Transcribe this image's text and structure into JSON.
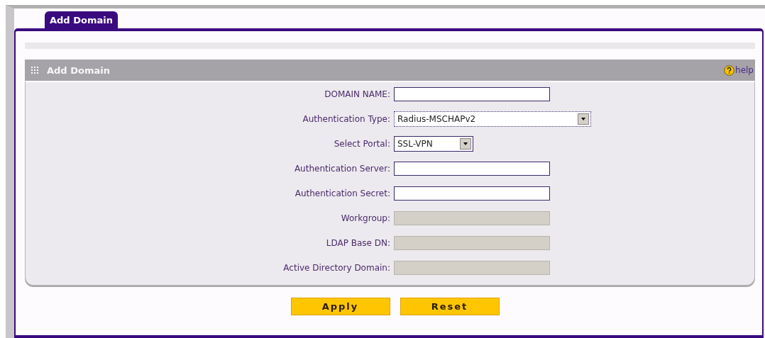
{
  "tabs": [
    {
      "label": "Add Domain",
      "selected": true
    }
  ],
  "section": {
    "title": "Add Domain",
    "help": "help"
  },
  "fields": [
    {
      "label": "DOMAIN NAME:",
      "kind": "text",
      "disabled": false
    },
    {
      "label": "Authentication Type:",
      "kind": "select",
      "value": "Radius-MSCHAPv2",
      "disabled": false
    },
    {
      "label": "Select Portal:",
      "kind": "select",
      "value": "SSL-VPN",
      "disabled": false
    },
    {
      "label": "Authentication Server:",
      "kind": "text",
      "disabled": false
    },
    {
      "label": "Authentication Secret:",
      "kind": "text",
      "disabled": false
    },
    {
      "label": "Workgroup:",
      "kind": "text",
      "disabled": true
    },
    {
      "label": "LDAP Base DN:",
      "kind": "text",
      "disabled": true
    },
    {
      "label": "Active Directory Domain:",
      "kind": "text",
      "disabled": true
    }
  ],
  "buttons": [
    "Apply",
    "Reset"
  ]
}
